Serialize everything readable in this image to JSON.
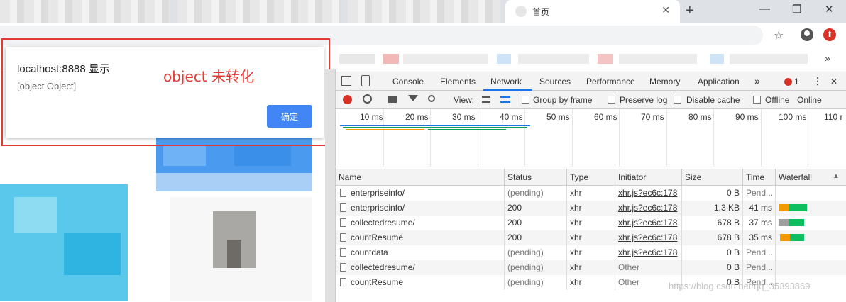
{
  "browser": {
    "tab_title": "首页",
    "tab_close": "✕",
    "new_tab": "+",
    "window_controls": [
      "—",
      "❐",
      "✕"
    ],
    "star": "☆",
    "update": "⬆",
    "bookmarks_more": "»"
  },
  "alert": {
    "title": "localhost:8888 显示",
    "message": "[object Object]",
    "ok_label": "确定"
  },
  "annotation": {
    "text": "object 未转化",
    "color": "#e53935"
  },
  "devtools": {
    "tabs": [
      "Console",
      "Elements",
      "Network",
      "Sources",
      "Performance",
      "Memory",
      "Application"
    ],
    "active_tab": "Network",
    "more_tabs": "»",
    "error_count": "1",
    "menu": "⋮",
    "close": "✕",
    "controls": {
      "view_label": "View:",
      "group_by_frame": "Group by frame",
      "preserve_log": "Preserve log",
      "disable_cache": "Disable cache",
      "offline": "Offline",
      "throttle": "Online"
    },
    "timeline_ticks": [
      "10 ms",
      "20 ms",
      "30 ms",
      "40 ms",
      "50 ms",
      "60 ms",
      "70 ms",
      "80 ms",
      "90 ms",
      "100 ms",
      "110 r"
    ],
    "columns": [
      "Name",
      "Status",
      "Type",
      "Initiator",
      "Size",
      "Time",
      "Waterfall"
    ],
    "sort_indicator": "▲",
    "rows": [
      {
        "name": "enterpriseinfo/",
        "status": "(pending)",
        "type": "xhr",
        "initiator": "xhr.js?ec6c:178",
        "size": "0 B",
        "time": "Pend..."
      },
      {
        "name": "enterpriseinfo/",
        "status": "200",
        "type": "xhr",
        "initiator": "xhr.js?ec6c:178",
        "size": "1.3 KB",
        "time": "41 ms"
      },
      {
        "name": "collectedresume/",
        "status": "200",
        "type": "xhr",
        "initiator": "xhr.js?ec6c:178",
        "size": "678 B",
        "time": "37 ms"
      },
      {
        "name": "countResume",
        "status": "200",
        "type": "xhr",
        "initiator": "xhr.js?ec6c:178",
        "size": "678 B",
        "time": "35 ms"
      },
      {
        "name": "countdata",
        "status": "(pending)",
        "type": "xhr",
        "initiator": "xhr.js?ec6c:178",
        "size": "0 B",
        "time": "Pend..."
      },
      {
        "name": "collectedresume/",
        "status": "(pending)",
        "type": "xhr",
        "initiator": "Other",
        "size": "0 B",
        "time": "Pend..."
      },
      {
        "name": "countResume",
        "status": "(pending)",
        "type": "xhr",
        "initiator": "Other",
        "size": "0 B",
        "time": "Pend..."
      }
    ]
  },
  "watermark": "https://blog.csdn.net/qq_35393869"
}
